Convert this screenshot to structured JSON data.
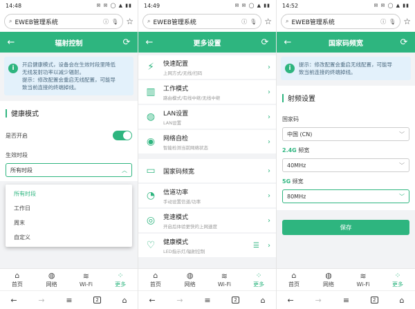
{
  "screens": [
    {
      "status_time": "14:48",
      "url": "EWEB管理系统",
      "title": "辐射控制",
      "notice_lines": [
        "开启健康模式，设备会在生效时段里降低",
        "无线发射功率以减少辐射。",
        "提示：修改配置会重启无线配置，可能导",
        "致当前连接的终端掉线。"
      ],
      "section": "健康模式",
      "enable_label": "是否开启",
      "period_label": "生效时段",
      "period_value": "所有时段",
      "dropdown": [
        "所有时段",
        "工作日",
        "周末",
        "自定义"
      ]
    },
    {
      "status_time": "14:49",
      "url": "EWEB管理系统",
      "title": "更多设置",
      "items": [
        {
          "title": "快速配置",
          "sub": "上网方式/无线/扫码"
        },
        {
          "title": "工作模式",
          "sub": "路由模式/有线中继/无线中继"
        },
        {
          "title": "LAN设置",
          "sub": "LAN设置"
        },
        {
          "title": "网络自检",
          "sub": "智能检测当前网络状态"
        },
        {
          "title": "国家码频宽",
          "sub": ""
        },
        {
          "title": "信道功率",
          "sub": "手动设置信道/功率"
        },
        {
          "title": "竞速模式",
          "sub": "开启后体验更快的上网速度"
        },
        {
          "title": "健康模式",
          "sub": "LED指示灯/辐射控制"
        }
      ]
    },
    {
      "status_time": "14:52",
      "url": "EWEB管理系统",
      "title": "国家码频宽",
      "notice_lines": [
        "提示：修改配置会重启无线配置，可能导",
        "致当前连接的终端掉线。"
      ],
      "section": "射频设置",
      "country_label": "国家码",
      "country_value": "中国 (CN)",
      "band24_em": "2.4G",
      "band24_suffix": " 频宽",
      "band24_value": "40MHz",
      "band5_em": "5G",
      "band5_suffix": " 频宽",
      "band5_value": "80MHz",
      "save_label": "保存"
    }
  ],
  "tabs": [
    "首页",
    "网络",
    "Wi-Fi",
    "更多"
  ],
  "nav": {
    "pages": "2"
  },
  "status_icons": "✉ ✉ ◯ ▲ ▮▮",
  "icons": {
    "back": "arrow-left-icon",
    "refresh": "refresh-icon",
    "lock": "info-icon",
    "tabs": [
      "home-icon",
      "globe-icon",
      "wifi-icon",
      "more-icon"
    ]
  },
  "accent_color": "#2eb57f"
}
